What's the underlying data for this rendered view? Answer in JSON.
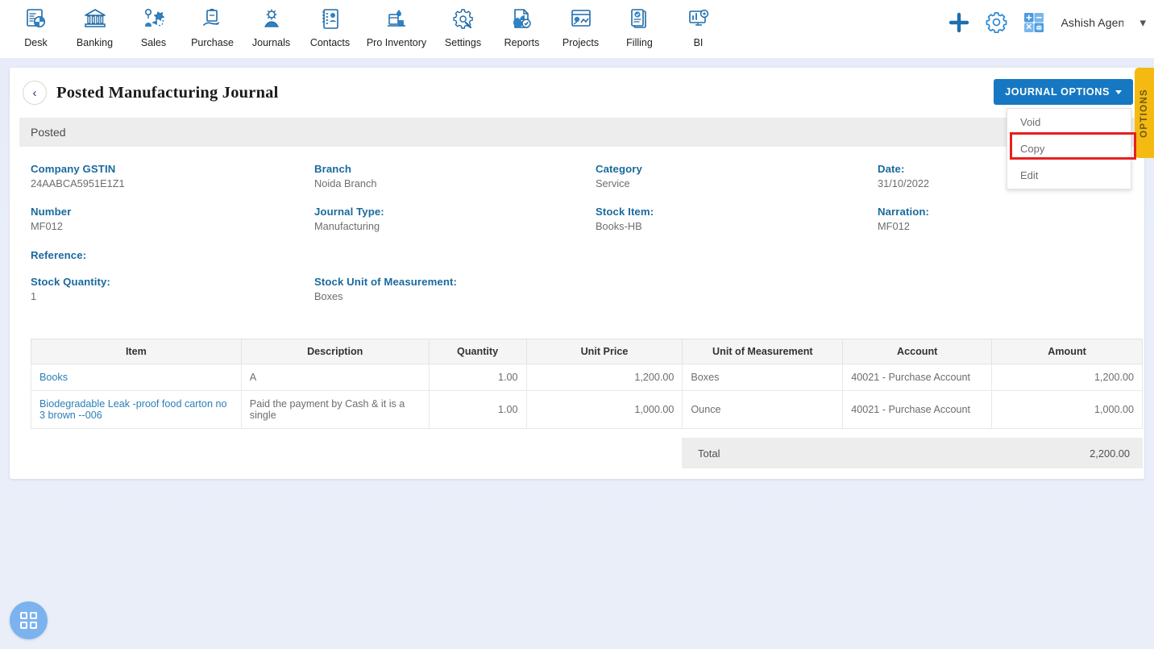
{
  "nav": {
    "items": [
      {
        "label": "Desk",
        "icon": "dashboard-icon"
      },
      {
        "label": "Banking",
        "icon": "bank-icon"
      },
      {
        "label": "Sales",
        "icon": "sales-icon"
      },
      {
        "label": "Purchase",
        "icon": "purchase-icon"
      },
      {
        "label": "Journals",
        "icon": "journals-icon"
      },
      {
        "label": "Contacts",
        "icon": "contacts-icon"
      },
      {
        "label": "Pro Inventory",
        "icon": "inventory-icon"
      },
      {
        "label": "Settings",
        "icon": "settings-icon"
      },
      {
        "label": "Reports",
        "icon": "reports-icon"
      },
      {
        "label": "Projects",
        "icon": "projects-icon"
      },
      {
        "label": "Filling",
        "icon": "filling-icon"
      },
      {
        "label": "BI",
        "icon": "bi-icon"
      }
    ],
    "right": {
      "add_icon": "plus-icon",
      "settings_icon": "gear-icon",
      "calculator_icon": "calculator-icon",
      "username": "Ashish Agenc",
      "chevron": "chevron-down-icon"
    }
  },
  "page": {
    "back_icon": "chevron-left-icon",
    "title": "Posted Manufacturing Journal",
    "status": "Posted"
  },
  "journal_options": {
    "button_label": "JOURNAL OPTIONS",
    "caret_icon": "caret-down-icon",
    "items": [
      {
        "label": "Void",
        "highlighted": false
      },
      {
        "label": "Copy",
        "highlighted": true
      },
      {
        "label": "Edit",
        "highlighted": false
      }
    ],
    "highlight_color": "#e8201f",
    "button_color": "#1678c2"
  },
  "options_tab": {
    "label": "OPTIONS",
    "color": "#f5ba12"
  },
  "details": {
    "company_gstin": {
      "label": "Company GSTIN",
      "value": "24AABCA5951E1Z1"
    },
    "branch": {
      "label": "Branch",
      "value": "Noida Branch"
    },
    "category": {
      "label": "Category",
      "value": "Service"
    },
    "date": {
      "label": "Date:",
      "value": "31/10/2022"
    },
    "number": {
      "label": "Number",
      "value": "MF012"
    },
    "journal_type": {
      "label": "Journal Type:",
      "value": "Manufacturing"
    },
    "stock_item": {
      "label": "Stock Item:",
      "value": "Books-HB"
    },
    "narration": {
      "label": "Narration:",
      "value": "MF012"
    },
    "reference": {
      "label": "Reference:",
      "value": ""
    },
    "stock_quantity": {
      "label": "Stock Quantity:",
      "value": "1"
    },
    "stock_uom": {
      "label": "Stock Unit of Measurement:",
      "value": "Boxes"
    }
  },
  "table": {
    "headers": [
      "Item",
      "Description",
      "Quantity",
      "Unit Price",
      "Unit of Measurement",
      "Account",
      "Amount"
    ],
    "rows": [
      {
        "item": "Books",
        "description": "A",
        "quantity": "1.00",
        "unit_price": "1,200.00",
        "uom": "Boxes",
        "account": "40021 - Purchase Account",
        "amount": "1,200.00"
      },
      {
        "item": "Biodegradable Leak -proof food carton no 3 brown --006",
        "description": "Paid the payment by Cash & it is a single",
        "quantity": "1.00",
        "unit_price": "1,000.00",
        "uom": "Ounce",
        "account": "40021 - Purchase Account",
        "amount": "1,000.00"
      }
    ],
    "total_label": "Total",
    "total_value": "2,200.00"
  },
  "fab": {
    "icon": "grid-apps-icon"
  }
}
